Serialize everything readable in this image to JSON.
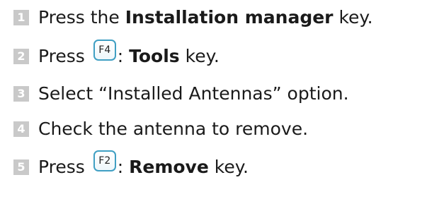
{
  "steps": [
    {
      "number": "1",
      "text_before": "Press the ",
      "bold": "Installation manager",
      "text_after": " key."
    },
    {
      "number": "2",
      "text_before": "Press ",
      "key": "F4",
      "text_colon": ": ",
      "bold": "Tools",
      "text_after": " key."
    },
    {
      "number": "3",
      "text": "Select “Installed Antennas” option."
    },
    {
      "number": "4",
      "text": "Check the antenna to remove."
    },
    {
      "number": "5",
      "text_before": "Press ",
      "key": "F2",
      "text_colon": ": ",
      "bold": "Remove",
      "text_after": " key."
    }
  ],
  "colors": {
    "number_badge": "#c9c9c9",
    "key_border": "#3f9fc3",
    "text": "#1a1a1a"
  }
}
